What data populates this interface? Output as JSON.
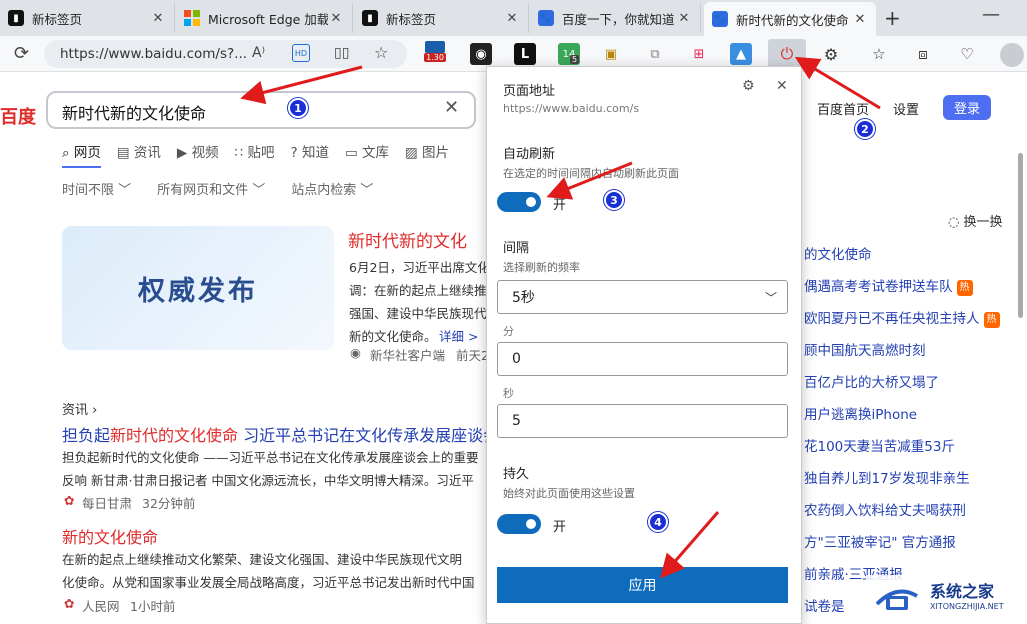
{
  "tabs": [
    {
      "title": "新标签页",
      "icon": "edge-new-tab-icon",
      "close": "✕"
    },
    {
      "title": "Microsoft Edge 加载项",
      "icon": "microsoft-logo-icon",
      "close": "✕"
    },
    {
      "title": "新标签页",
      "icon": "edge-new-tab-icon",
      "close": "✕"
    },
    {
      "title": "百度一下，你就知道",
      "icon": "baidu-paw-icon",
      "close": "✕"
    },
    {
      "title": "新时代新的文化使命",
      "icon": "baidu-paw-icon",
      "close": "✕"
    }
  ],
  "tabbar": {
    "new_tab": "+",
    "minimize": "—"
  },
  "address": {
    "url": "https://www.baidu.com/s?...",
    "ext_badge_1": "1.30",
    "ext_badge_2": "5"
  },
  "search": {
    "logo": "百度",
    "query": "新时代新的文化使命",
    "clear": "✕",
    "home": "百度首页",
    "settings": "设置",
    "login": "登录"
  },
  "search_tabs": [
    "网页",
    "资讯",
    "视频",
    "贴吧",
    "知道",
    "文库",
    "图片"
  ],
  "filters": [
    "时间不限 ﹀",
    "所有网页和文件 ﹀",
    "站点内检索 ﹀"
  ],
  "news_card": {
    "image_text": "权威发布",
    "title": "新时代新的文化",
    "lines": [
      "6月2日，习近平出席文化",
      "调：在新的起点上继续推",
      "强国、建设中华民族现代",
      "新的文化使命。"
    ],
    "detail": "详细 >",
    "source": "新华社客户端",
    "time": "前天2"
  },
  "result1": {
    "section": "资讯 ›",
    "title_prefix": "担负起",
    "title_hl": "新时代的文化使命",
    "title_suffix": " 习近平总书记在文化传承发展座谈会",
    "lines": [
      "担负起新时代的文化使命 ——习近平总书记在文化传承发展座谈会上的重要",
      "反响 新甘肃·甘肃日报记者 中国文化源远流长，中华文明博大精深。习近平"
    ],
    "source": "每日甘肃",
    "time": "32分钟前"
  },
  "result2": {
    "title": "新的文化使命",
    "lines": [
      "在新的起点上继续推动文化繁荣、建设文化强国、建设中华民族现代文明",
      "化使命。从党和国家事业发展全局战略高度，习近平总书记发出新时代中国"
    ],
    "source": "人民网",
    "time": "1小时前"
  },
  "hot": {
    "refresh": "换一换",
    "items": [
      {
        "text": "的文化使命",
        "badge": ""
      },
      {
        "text": "偶遇高考考试卷押送车队",
        "badge": "热"
      },
      {
        "text": "欧阳夏丹已不再任央视主持人",
        "badge": "热"
      },
      {
        "text": "顾中国航天高燃时刻",
        "badge": ""
      },
      {
        "text": "百亿卢比的大桥又塌了",
        "badge": ""
      },
      {
        "text": "用户逃离换iPhone",
        "badge": ""
      },
      {
        "text": "花100天妻当苦减重53斤",
        "badge": ""
      },
      {
        "text": "独自养儿到17岁发现非亲生",
        "badge": ""
      },
      {
        "text": "农药倒入饮料给丈夫喝获刑",
        "badge": ""
      },
      {
        "text": "方\"三亚被宰记\" 官方通报",
        "badge": ""
      },
      {
        "text": "前亲戚·三亚通报",
        "badge": ""
      },
      {
        "text": "试卷是",
        "badge": ""
      }
    ]
  },
  "panel": {
    "page_addr_label": "页面地址",
    "page_addr": "https://www.baidu.com/s",
    "auto_refresh_label": "自动刷新",
    "auto_refresh_desc": "在选定的时间间隔内自动刷新此页面",
    "toggle_on": "开",
    "interval_label": "间隔",
    "interval_desc": "选择刷新的频率",
    "interval_value": "5秒",
    "minutes_label": "分",
    "minutes_value": "0",
    "seconds_label": "秒",
    "seconds_value": "5",
    "persist_label": "持久",
    "persist_desc": "始终对此页面使用这些设置",
    "persist_on": "开",
    "apply": "应用",
    "settings_icon": "⚙",
    "close_icon": "✕"
  },
  "annotations": [
    "1",
    "2",
    "3",
    "4"
  ],
  "watermark": {
    "title": "系统之家",
    "sub": "XITONGZHIJIA.NET"
  },
  "colors": {
    "accent": "#0f6cbd",
    "baidu_blue": "#4e6ef2",
    "baidu_red": "#e02b2b",
    "arrow": "#e01b1b",
    "badge": "#1a2fd6"
  }
}
